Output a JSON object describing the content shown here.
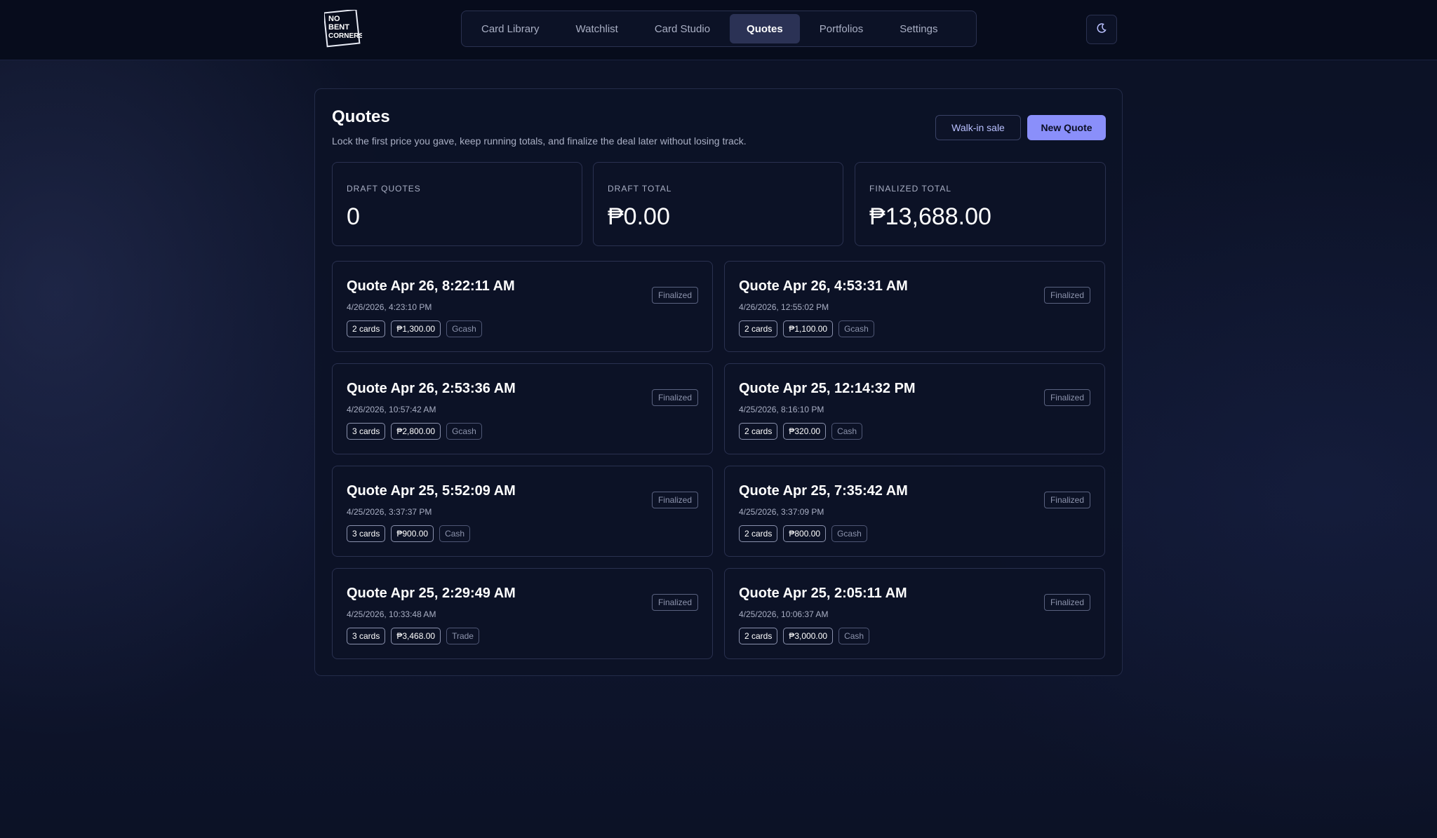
{
  "nav": {
    "items": [
      {
        "label": "Card Library",
        "active": false
      },
      {
        "label": "Watchlist",
        "active": false
      },
      {
        "label": "Card Studio",
        "active": false
      },
      {
        "label": "Quotes",
        "active": true
      },
      {
        "label": "Portfolios",
        "active": false
      },
      {
        "label": "Settings",
        "active": false
      }
    ],
    "theme_icon": "moon-icon",
    "logo_text": "NO BENT CORNERS"
  },
  "page": {
    "title": "Quotes",
    "subtitle": "Lock the first price you gave, keep running totals, and finalize the deal later without losing track.",
    "walkin_label": "Walk-in sale",
    "new_quote_label": "New Quote"
  },
  "stats": [
    {
      "label": "DRAFT QUOTES",
      "value": "0"
    },
    {
      "label": "DRAFT TOTAL",
      "value": "₱0.00"
    },
    {
      "label": "FINALIZED TOTAL",
      "value": "₱13,688.00"
    }
  ],
  "colors": {
    "accent": "#8a8ffa",
    "background": "#0d1326"
  },
  "quotes": [
    {
      "title": "Quote Apr 26, 8:22:11 AM",
      "date": "4/26/2026, 4:23:10 PM",
      "status": "Finalized",
      "cards": "2 cards",
      "amount": "₱1,300.00",
      "method": "Gcash"
    },
    {
      "title": "Quote Apr 26, 4:53:31 AM",
      "date": "4/26/2026, 12:55:02 PM",
      "status": "Finalized",
      "cards": "2 cards",
      "amount": "₱1,100.00",
      "method": "Gcash"
    },
    {
      "title": "Quote Apr 26, 2:53:36 AM",
      "date": "4/26/2026, 10:57:42 AM",
      "status": "Finalized",
      "cards": "3 cards",
      "amount": "₱2,800.00",
      "method": "Gcash"
    },
    {
      "title": "Quote Apr 25, 12:14:32 PM",
      "date": "4/25/2026, 8:16:10 PM",
      "status": "Finalized",
      "cards": "2 cards",
      "amount": "₱320.00",
      "method": "Cash"
    },
    {
      "title": "Quote Apr 25, 5:52:09 AM",
      "date": "4/25/2026, 3:37:37 PM",
      "status": "Finalized",
      "cards": "3 cards",
      "amount": "₱900.00",
      "method": "Cash"
    },
    {
      "title": "Quote Apr 25, 7:35:42 AM",
      "date": "4/25/2026, 3:37:09 PM",
      "status": "Finalized",
      "cards": "2 cards",
      "amount": "₱800.00",
      "method": "Gcash"
    },
    {
      "title": "Quote Apr 25, 2:29:49 AM",
      "date": "4/25/2026, 10:33:48 AM",
      "status": "Finalized",
      "cards": "3 cards",
      "amount": "₱3,468.00",
      "method": "Trade"
    },
    {
      "title": "Quote Apr 25, 2:05:11 AM",
      "date": "4/25/2026, 10:06:37 AM",
      "status": "Finalized",
      "cards": "2 cards",
      "amount": "₱3,000.00",
      "method": "Cash"
    }
  ]
}
